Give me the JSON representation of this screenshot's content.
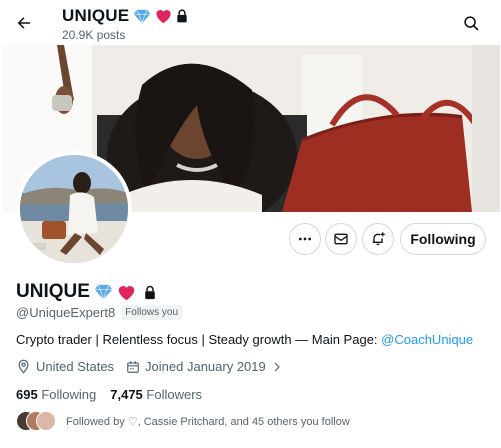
{
  "header": {
    "title": "UNIQUE",
    "post_count": "20.9K posts"
  },
  "profile": {
    "display_name": "UNIQUE",
    "handle": "@UniqueExpert8",
    "follows_you": "Follows you",
    "bio_text": "Crypto trader | Relentless focus | Steady growth — Main Page: ",
    "bio_link": "@CoachUnique",
    "location": "United States",
    "joined": "Joined January 2019",
    "following_count": "695",
    "following_label": "Following",
    "followers_count": "7,475",
    "followers_label": "Followers",
    "followed_by": "Followed by ♡, Cassie Pritchard, and 45 others you follow"
  },
  "actions": {
    "following_button": "Following"
  },
  "icons": [
    "back-arrow-icon",
    "search-icon",
    "diamond-icon",
    "heart-icon",
    "lock-icon",
    "more-icon",
    "mail-icon",
    "notification-icon",
    "location-icon",
    "calendar-icon",
    "chevron-right-icon"
  ],
  "colors": {
    "link": "#1d9bf0",
    "heart": "#e0245e",
    "diamond": "#5aa8e6",
    "muted": "#536471"
  }
}
